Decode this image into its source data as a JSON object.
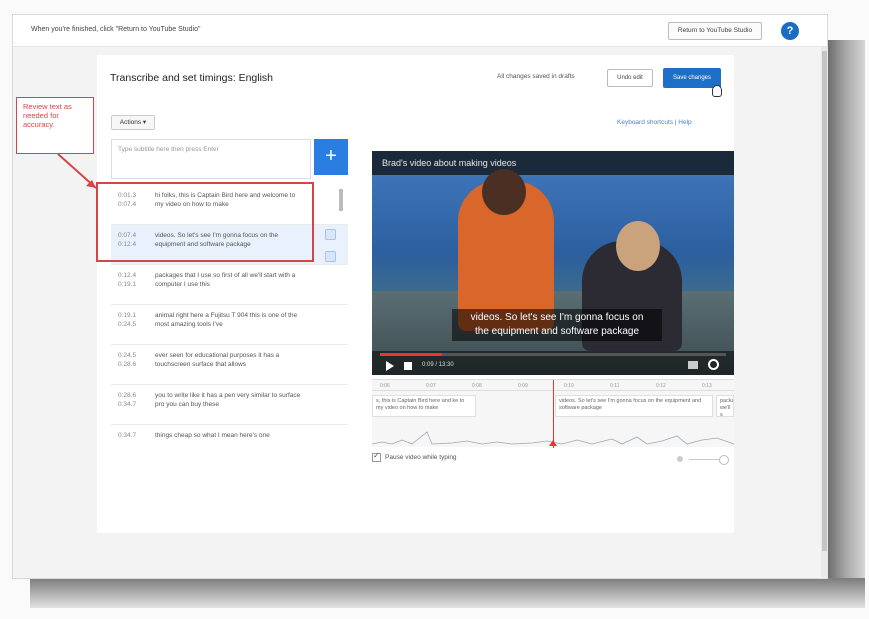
{
  "topbar": {
    "message": "When you're finished, click \"Return to YouTube Studio\"",
    "return_button": "Return to YouTube Studio"
  },
  "editor": {
    "title": "Transcribe and set timings: English",
    "saved_status": "All changes saved in drafts",
    "undo_label": "Undo edit",
    "save_label": "Save changes",
    "actions_label": "Actions ▾",
    "keyboard_links": "Keyboard shortcuts  |  Help",
    "input_placeholder": "Type subtitle here then press Enter",
    "add_label": "+"
  },
  "callout": {
    "text": "Review text as needed for accuracy."
  },
  "cues": [
    {
      "start": "0:01.3",
      "end": "0:07.4",
      "text": "hi folks, this is Captain Bird here and welcome to my video on how to make",
      "active": false
    },
    {
      "start": "0:07.4",
      "end": "0:12.4",
      "text": "videos. So let's see I'm gonna focus on the equipment and software package",
      "active": true
    },
    {
      "start": "0:12.4",
      "end": "0:19.1",
      "text": "packages that I use so first of all we'll start with a computer I use this",
      "active": false
    },
    {
      "start": "0:19.1",
      "end": "0:24.5",
      "text": "animal right here a Fujitsu T 904 this is one of the most amazing tools I've",
      "active": false
    },
    {
      "start": "0:24.5",
      "end": "0:28.6",
      "text": "ever seen for educational purposes it has a touchscreen surface that allows",
      "active": false
    },
    {
      "start": "0:28.6",
      "end": "0:34.7",
      "text": "you to write like it has a pen very similar to surface pro you can buy these",
      "active": false
    },
    {
      "start": "0:34.7",
      "end": "",
      "text": "things cheap so what I mean here's one",
      "active": false
    }
  ],
  "player": {
    "video_title": "Brad's video about making videos",
    "caption_line1": "videos. So let's see I'm gonna focus on",
    "caption_line2": "the equipment and software package",
    "time_text": "0:09 / 13:30",
    "progress_fraction": 0.18
  },
  "timeline": {
    "ruler_labels": [
      "0:06",
      "0:07",
      "0:08",
      "0:09",
      "0:10",
      "0:11",
      "0:12",
      "0:13"
    ],
    "cues": [
      {
        "text": "s, this is Captain Bird here and ke to my video on how to make"
      },
      {
        "text": "videos. So let's see I'm gonna focus on the equipment and software package"
      },
      {
        "text": "packa we'll s"
      }
    ]
  },
  "pause_option": {
    "label": "Pause video while typing",
    "checked": true
  },
  "colors": {
    "accent": "#1e6fc7",
    "annotation": "#d64545"
  }
}
